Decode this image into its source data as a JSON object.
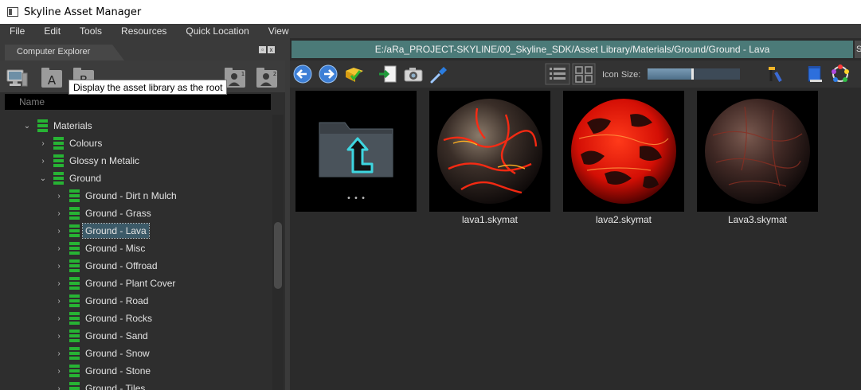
{
  "window": {
    "title": "Skyline Asset Manager"
  },
  "menu": [
    "File",
    "Edit",
    "Tools",
    "Resources",
    "Quick Location",
    "View"
  ],
  "left_panel": {
    "tab_label": "Computer Explorer",
    "toolbar": {
      "a_label": "A",
      "b_label": "B",
      "user1": "1",
      "user2": "2"
    },
    "tooltip": "Display the asset library as the root",
    "column_header": "Name",
    "tree": [
      {
        "label": "Materials",
        "arrow": "⌄",
        "level": 0
      },
      {
        "label": "Colours",
        "arrow": "›",
        "level": 1
      },
      {
        "label": "Glossy n Metalic",
        "arrow": "›",
        "level": 1
      },
      {
        "label": "Ground",
        "arrow": "⌄",
        "level": 1
      },
      {
        "label": "Ground - Dirt n Mulch",
        "arrow": "›",
        "level": 2
      },
      {
        "label": "Ground - Grass",
        "arrow": "›",
        "level": 2
      },
      {
        "label": "Ground - Lava",
        "arrow": "›",
        "level": 2,
        "selected": true
      },
      {
        "label": "Ground - Misc",
        "arrow": "›",
        "level": 2
      },
      {
        "label": "Ground - Offroad",
        "arrow": "›",
        "level": 2
      },
      {
        "label": "Ground - Plant Cover",
        "arrow": "›",
        "level": 2
      },
      {
        "label": "Ground - Road",
        "arrow": "›",
        "level": 2
      },
      {
        "label": "Ground - Rocks",
        "arrow": "›",
        "level": 2
      },
      {
        "label": "Ground - Sand",
        "arrow": "›",
        "level": 2
      },
      {
        "label": "Ground - Snow",
        "arrow": "›",
        "level": 2
      },
      {
        "label": "Ground - Stone",
        "arrow": "›",
        "level": 2
      },
      {
        "label": "Ground - Tiles",
        "arrow": "›",
        "level": 2
      }
    ]
  },
  "right_panel": {
    "path": "E:/aRa_PROJECT-SKYLINE/00_Skyline_SDK/Asset Library/Materials/Ground/Ground - Lava",
    "path_end": "S",
    "icon_size_label": "Icon Size:",
    "icon_size_level": 0.47,
    "up_folder_dots": "• • •",
    "assets": [
      {
        "name": "",
        "kind": "up-folder"
      },
      {
        "name": "lava1.skymat",
        "kind": "lava1"
      },
      {
        "name": "lava2.skymat",
        "kind": "lava2"
      },
      {
        "name": "Lava3.skymat",
        "kind": "lava3"
      }
    ]
  },
  "colors": {
    "path_bar": "#4b7a78",
    "folder_icon": "#27b334",
    "selection": "#3c5a68"
  }
}
